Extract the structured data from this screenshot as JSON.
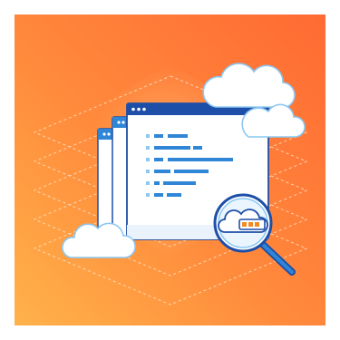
{
  "illustration": {
    "subject": "cloud-log-inspection",
    "icons": [
      "cloud-icon",
      "browser-window-icon",
      "code-lines-icon",
      "magnifying-glass-icon",
      "cloud-progress-icon"
    ],
    "colors": {
      "background_top_right": "#FF6B35",
      "background_bottom_left": "#FFB347",
      "window_frame": "#1E4FA8",
      "window_body": "#FFFFFF",
      "code_line": "#2F86D6",
      "code_bullet": "#8CC8F2",
      "cloud_fill": "#FFFFFF",
      "cloud_stroke": "#8CC8F2",
      "progress_fill": "#F08A24"
    }
  }
}
